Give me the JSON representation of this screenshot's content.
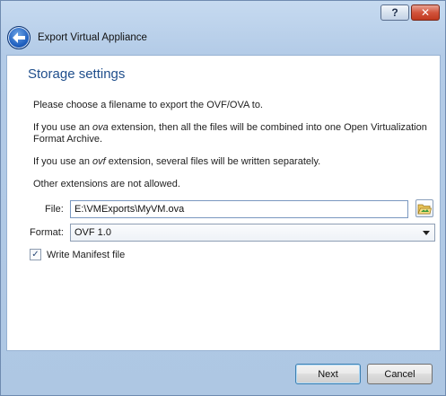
{
  "window": {
    "title": "Export Virtual Appliance",
    "help_label": "?",
    "close_label": "✕"
  },
  "page": {
    "heading": "Storage settings",
    "para1": "Please choose a filename to export the OVF/OVA to.",
    "para2_prefix": "If you use an ",
    "para2_ext": "ova",
    "para2_suffix": " extension, then all the files will be combined into one Open Virtualization Format Archive.",
    "para3_prefix": "If you use an ",
    "para3_ext": "ovf",
    "para3_suffix": " extension, several files will be written separately.",
    "para4": "Other extensions are not allowed."
  },
  "file": {
    "label": "File:",
    "value": "E:\\VMExports\\MyVM.ova"
  },
  "format": {
    "label": "Format:",
    "selected": "OVF 1.0"
  },
  "manifest": {
    "label": "Write Manifest file",
    "checked": true,
    "check_glyph": "✓"
  },
  "buttons": {
    "next": "Next",
    "cancel": "Cancel"
  },
  "colors": {
    "heading": "#1f4e8c",
    "frame": "#bcd2ea",
    "close": "#c0391f"
  },
  "icons": {
    "back": "back-arrow-icon",
    "browse": "folder-browse-icon"
  }
}
